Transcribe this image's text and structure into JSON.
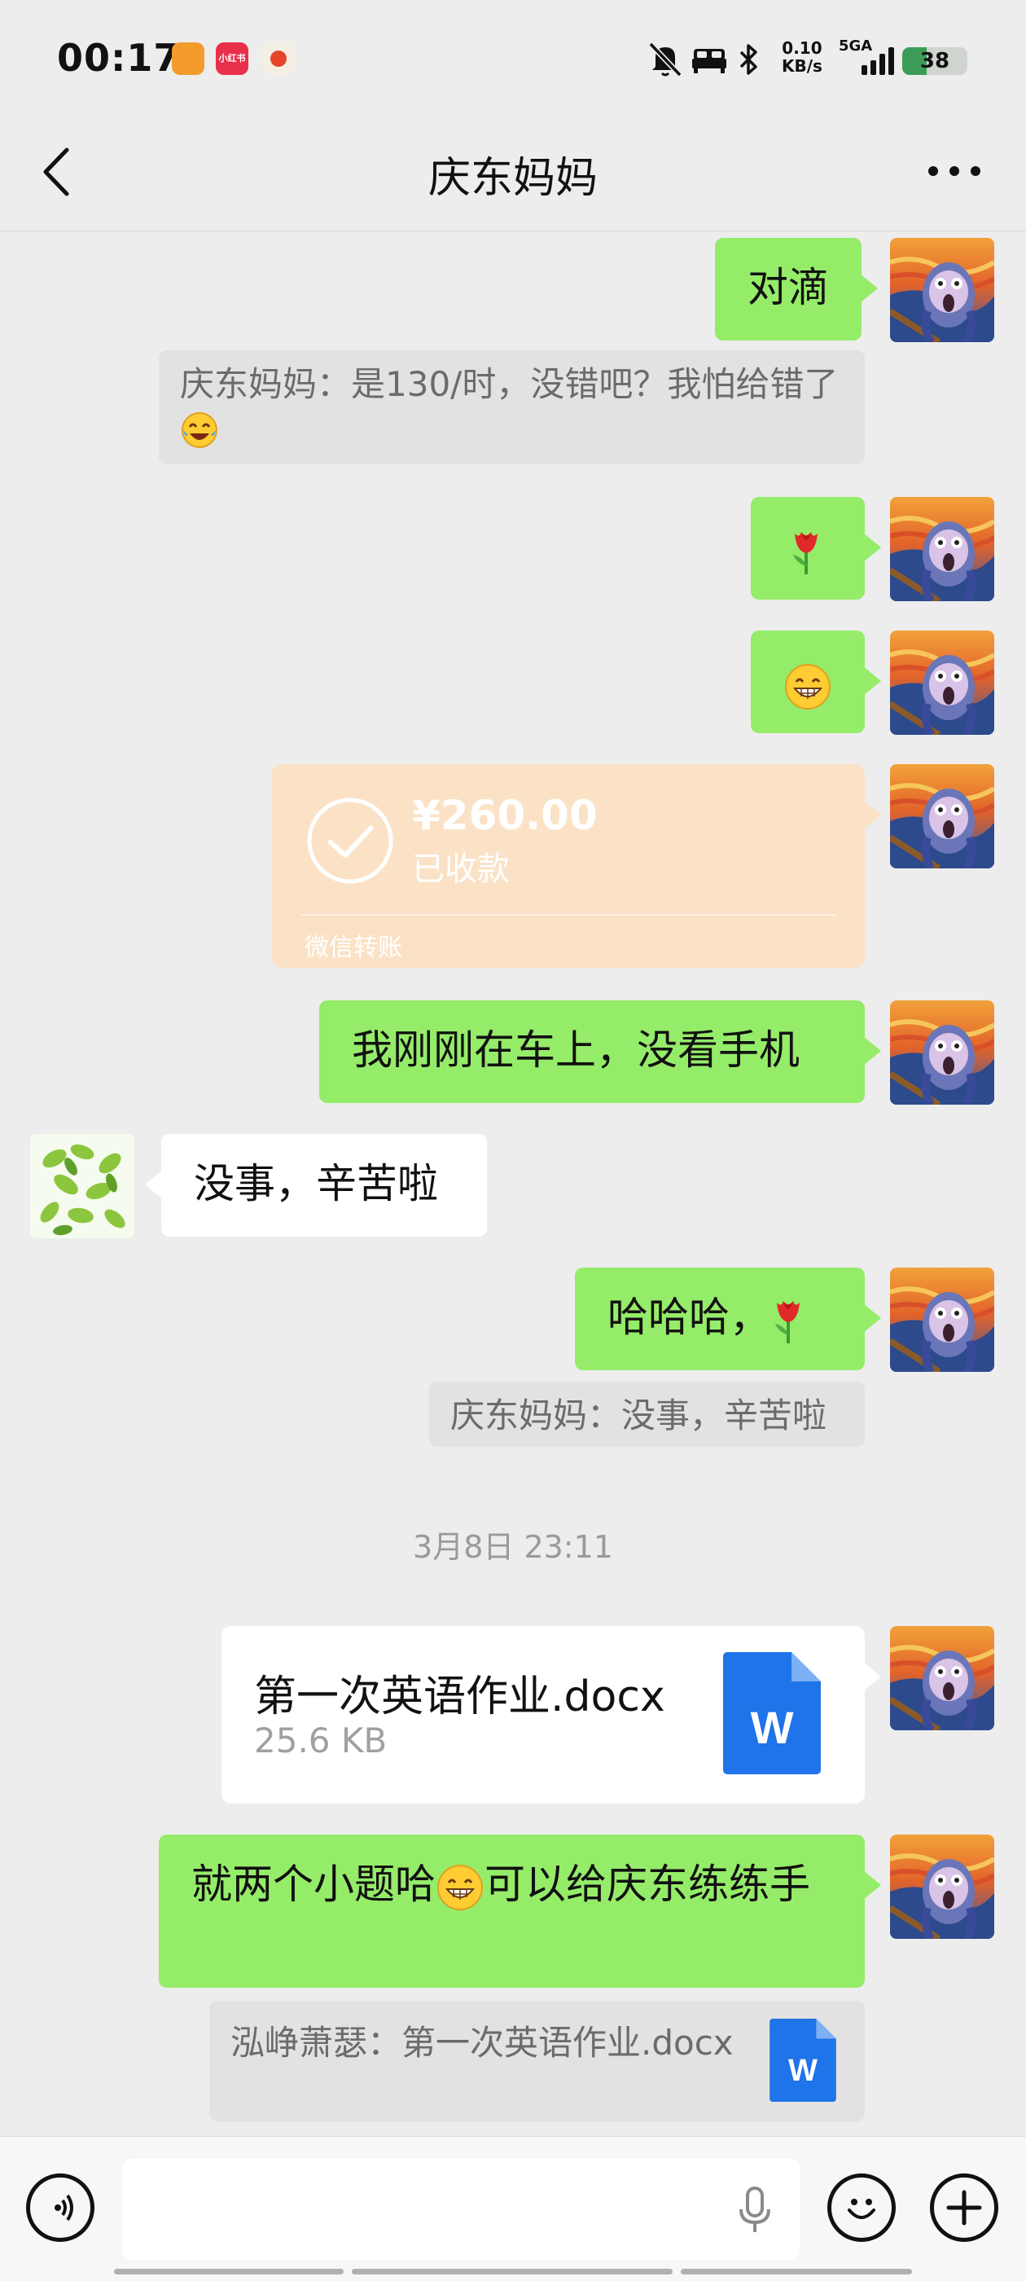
{
  "status_bar": {
    "time": "00:17",
    "app_icons": [
      "orange-app-icon",
      "xiaohongshu-icon",
      "tomato-app-icon"
    ],
    "app_icon_2_label": "小红书",
    "net_speed_value": "0.10",
    "net_speed_unit": "KB/s",
    "net_type": "5GA",
    "battery": "38"
  },
  "header": {
    "title": "庆东妈妈"
  },
  "messages": {
    "m1": "对滴",
    "q1": "庆东妈妈：是130/时，没错吧？我怕给错了",
    "m2_emoji": "tulip",
    "m3_emoji": "grin",
    "transfer": {
      "amount": "¥260.00",
      "status": "已收款",
      "footer": "微信转账"
    },
    "m4": "我刚刚在车上，没看手机",
    "m5": "没事，辛苦啦",
    "m6": "哈哈哈，",
    "q2": "庆东妈妈：没事，辛苦啦",
    "timestamp": "3月8日 23:11",
    "file": {
      "name": "第一次英语作业.docx",
      "size": "25.6 KB",
      "icon_letter": "W"
    },
    "m7_part1": "就两个小题哈",
    "m7_part2": "可以给庆东练练手",
    "q3": "泓峥萧瑟：第一次英语作业.docx",
    "q3_icon_letter": "W"
  },
  "colors": {
    "bg": "#ededed",
    "green_bubble": "#95ec69",
    "transfer_bg": "#fbe2c6",
    "word_blue": "#1e74e8"
  }
}
